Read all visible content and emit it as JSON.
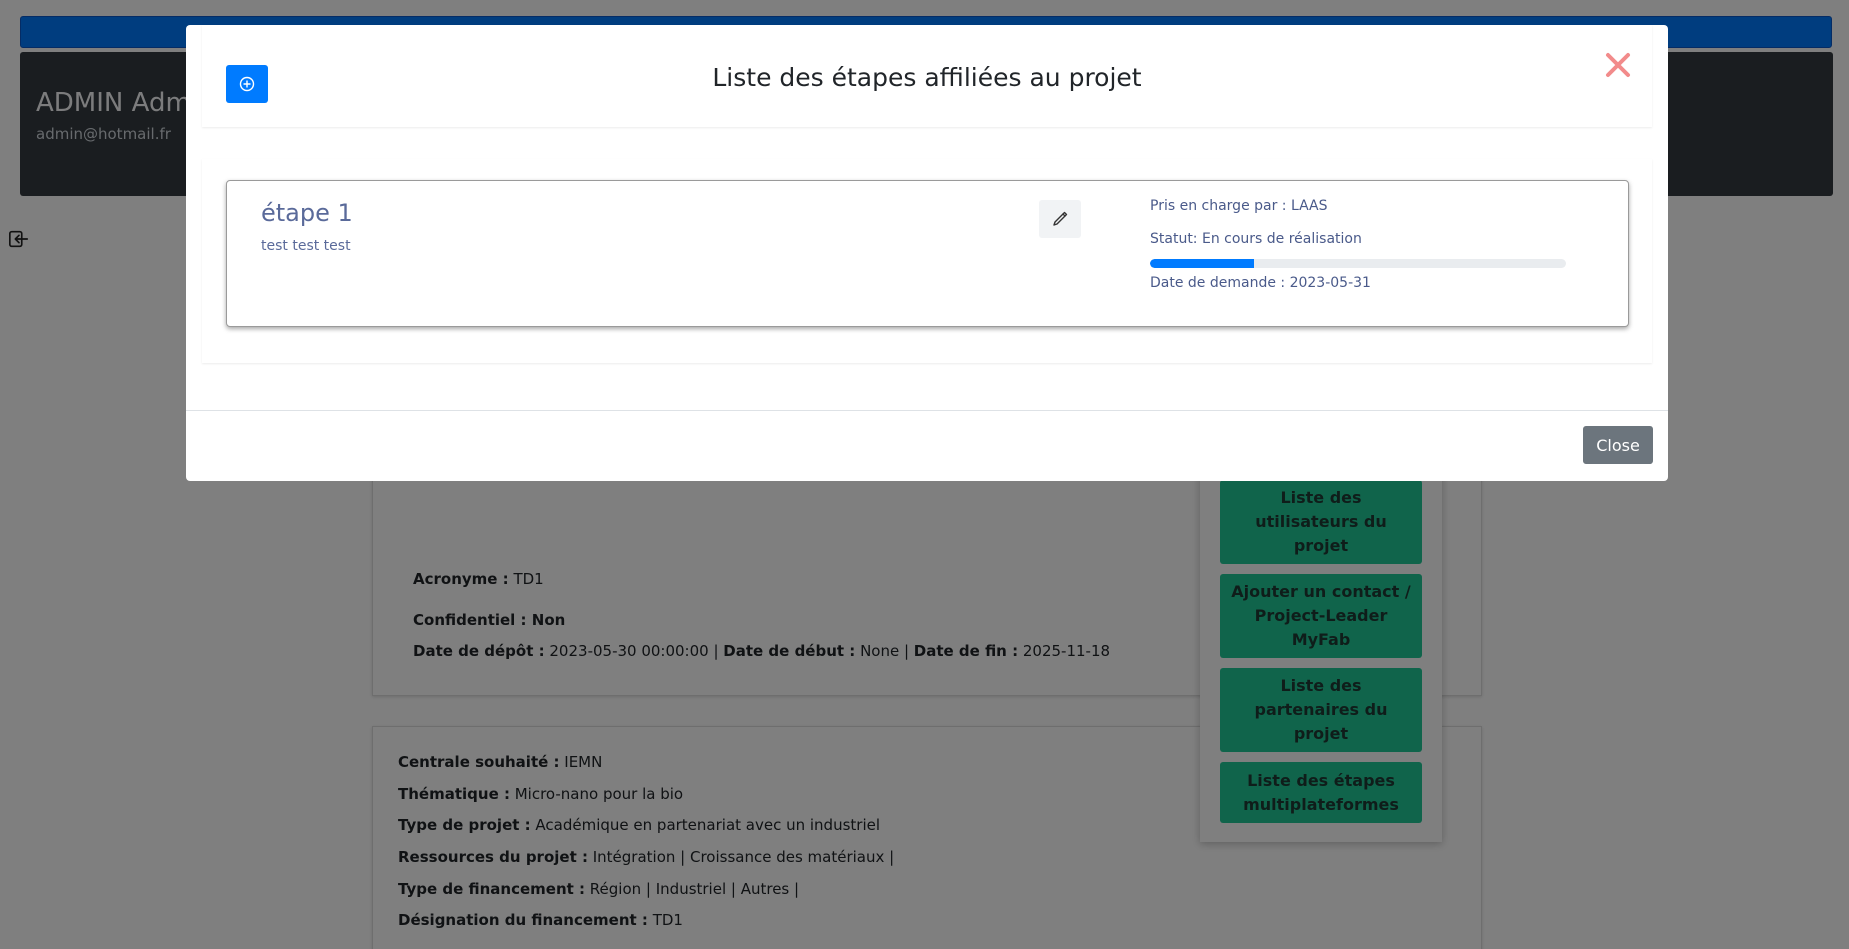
{
  "header": {
    "user_name": "ADMIN Admin",
    "user_email": "admin@hotmail.fr"
  },
  "project": {
    "acronyme_label": "Acronyme :",
    "acronyme_value": " TD1",
    "confidentiel_label": "Confidentiel : Non",
    "date_depot_label": "Date de dépôt :",
    "date_depot_value": " 2023-05-30 00:00:00 | ",
    "date_debut_label": "Date de début :",
    "date_debut_value": " None | ",
    "date_fin_label": "Date de fin :",
    "date_fin_value": " 2025-11-18",
    "centrale_label": "Centrale souhaité :",
    "centrale_value": " IEMN",
    "thematique_label": "Thématique :",
    "thematique_value": " Micro-nano pour la bio",
    "type_projet_label": "Type de projet :",
    "type_projet_value": " Académique en partenariat avec un industriel",
    "ressources_label": "Ressources du projet :",
    "ressources_value": " Intégration | Croissance des matériaux |",
    "type_financement_label": "Type de financement :",
    "type_financement_value": "  Région | Industriel | Autres |",
    "designation_label": "Désignation du financement :",
    "designation_value": " TD1"
  },
  "actions": {
    "users_list": "Liste des utilisateurs du projet",
    "add_contact": "Ajouter un contact / Project-Leader MyFab",
    "partners_list": "Liste des partenaires du projet",
    "multiplatform_steps": "Liste des étapes multiplateformes"
  },
  "modal": {
    "title": "Liste des étapes affiliées au projet",
    "close_label": "Close",
    "steps": [
      {
        "title": "étape 1",
        "description": "test test test",
        "handled_by": "Pris en charge par : LAAS",
        "status": "Statut: En cours de réalisation",
        "progress_fraction": 0.25,
        "request_date": "Date de demande : 2023-05-31"
      }
    ]
  },
  "colors": {
    "primary": "#007bff",
    "dark_header": "#343a40",
    "action_teal": "#20c997",
    "close_x": "#f28b8b",
    "secondary": "#6c757d",
    "step_text": "#5a6a9a"
  },
  "icons": {
    "add": "plus-circle-icon",
    "close": "close-icon",
    "edit": "pencil-icon",
    "logout": "logout-icon"
  }
}
